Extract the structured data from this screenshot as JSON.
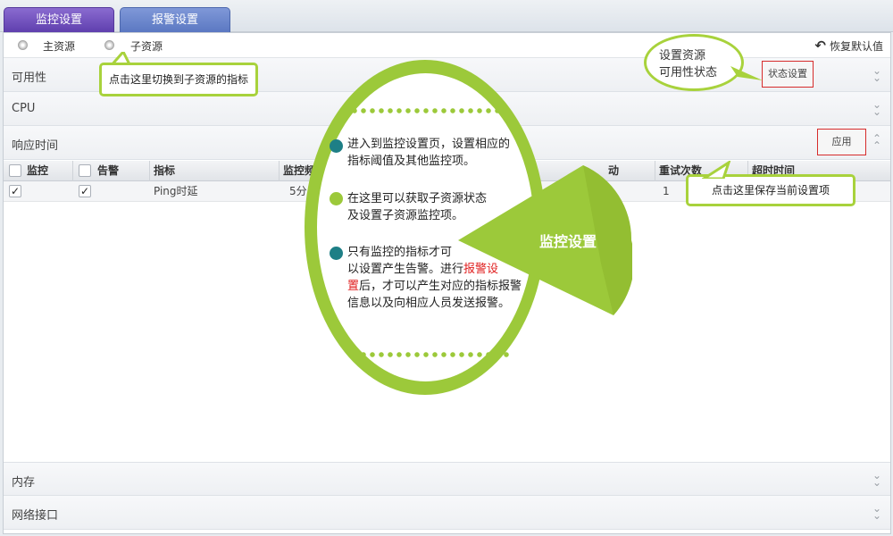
{
  "tabs": [
    {
      "label": "监控设置"
    },
    {
      "label": "报警设置"
    }
  ],
  "resource_toggle": {
    "main_label": "主资源",
    "sub_label": "子资源",
    "restore_label": "恢复默认值"
  },
  "sections": {
    "availability": "可用性",
    "cpu": "CPU",
    "response_time": "响应时间",
    "memory": "内存",
    "network": "网络接口"
  },
  "buttons": {
    "status_settings": "状态设置",
    "apply": "应用"
  },
  "table": {
    "headers": [
      "监控",
      "告警",
      "指标",
      "监控频",
      "动",
      "重试次数",
      "超时时间"
    ],
    "row": {
      "metric": "Ping时延",
      "frequency": "5分",
      "retries": "1"
    }
  },
  "callouts": {
    "switch_sub": "点击这里切换到子资源的指标",
    "save_current": "点击这里保存当前设置项",
    "availability_bubble_line1": "设置资源",
    "availability_bubble_line2": "可用性状态"
  },
  "guide": {
    "title": "监控设置",
    "item1_line1": "进入到监控设置页，设置相应的",
    "item1_line2": "指标阈值及其他监控项。",
    "item2_line1": "在这里可以获取子资源状态",
    "item2_line2": "及设置子资源监控项。",
    "item3_line1": "只有监控的指标才可",
    "item3_line2a": "以设置产生告警。进行",
    "item3_highlight_a": "报警设",
    "item3_highlight_b": "置",
    "item3_line3b": "后，才可以产生对应的指标报警",
    "item3_line4": "信息以及向相应人员发送报警。"
  },
  "colors": {
    "accent_green": "#9cc93a",
    "teal_dot": "#1e7f86",
    "light_green_dot": "#9cc93a",
    "highlight_red": "#e02020"
  }
}
